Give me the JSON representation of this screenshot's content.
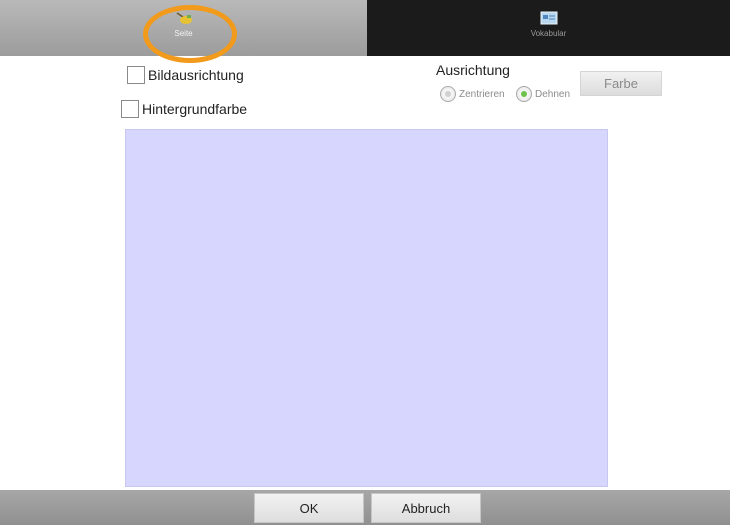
{
  "tabs": [
    {
      "label": "Seite",
      "icon": "page-pencil-icon"
    },
    {
      "label": "Vokabular",
      "icon": "vocabulary-card-icon"
    }
  ],
  "options": {
    "image_alignment_label": "Bildausrichtung",
    "background_color_label": "Hintergrundfarbe"
  },
  "alignment": {
    "title": "Ausrichtung",
    "options": [
      {
        "label": "Zentrieren",
        "selected": false
      },
      {
        "label": "Dehnen",
        "selected": true
      }
    ],
    "color_button": "Farbe"
  },
  "preview": {
    "background_color": "#d6d6fe"
  },
  "footer": {
    "ok_label": "OK",
    "cancel_label": "Abbruch"
  },
  "colors": {
    "highlight": "#f29a1b",
    "radio_selected": "#6cc24a"
  }
}
